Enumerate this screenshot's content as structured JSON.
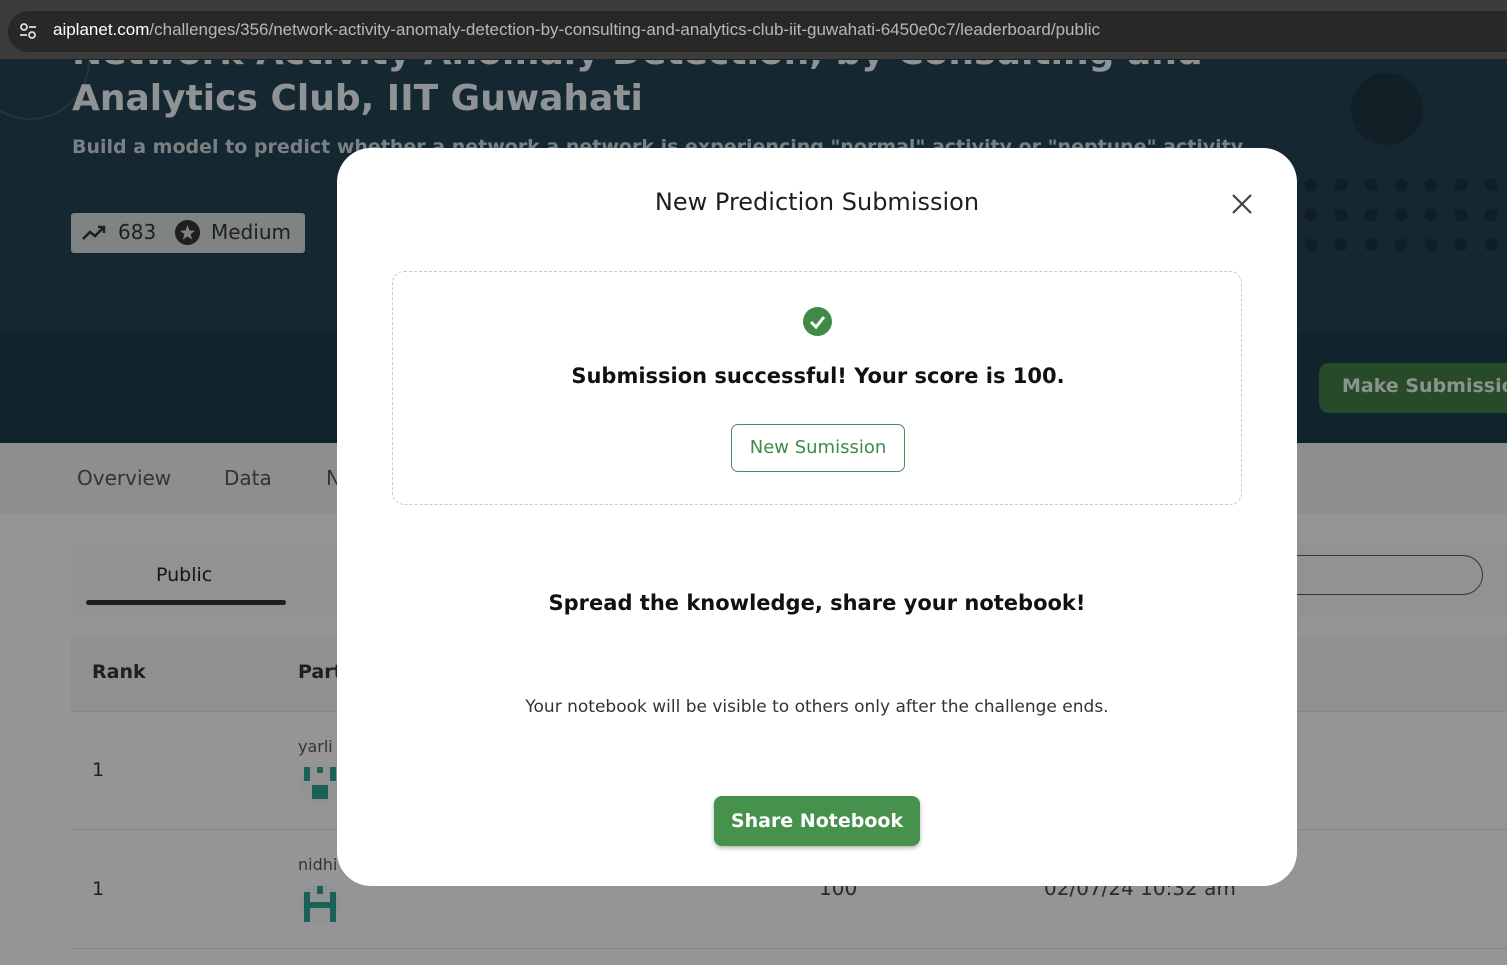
{
  "browser": {
    "url_host": "aiplanet.com",
    "url_path": "/challenges/356/network-activity-anomaly-detection-by-consulting-and-analytics-club-iit-guwahati-6450e0c7/leaderboard/public",
    "icons": {
      "site_info": "tune-icon"
    }
  },
  "hero": {
    "title": "Network Activity Anomaly Detection, by Consulting and Analytics Club, IIT Guwahati",
    "subtitle": "Build a model to predict whether a network a network is experiencing \"normal\" activity or \"neptune\" activity",
    "participants_count": "683",
    "difficulty": "Medium",
    "icons": {
      "count": "trending-up-icon",
      "difficulty": "star-badge-icon"
    }
  },
  "actions": {
    "make_submission_label": "Make Submission"
  },
  "tabs": [
    {
      "label": "Overview"
    },
    {
      "label": "Data"
    },
    {
      "label": "N"
    }
  ],
  "leaderboard": {
    "active_tab": "Public",
    "columns": {
      "rank": "Rank",
      "participant": "Part"
    },
    "rows": [
      {
        "rank": "1",
        "user": "yarli",
        "score": "",
        "date": ""
      },
      {
        "rank": "1",
        "user": "nidhi",
        "score": "100",
        "date": "02/07/24 10:32 am"
      }
    ]
  },
  "modal": {
    "title": "New Prediction Submission",
    "success_message": "Submission successful! Your score is 100.",
    "new_submission_label": "New Sumission",
    "share_heading": "Spread the knowledge, share your notebook!",
    "visibility_note": "Your notebook will be visible to others only after the challenge ends.",
    "share_button_label": "Share Notebook",
    "icons": {
      "close": "close-icon",
      "success": "check-circle-icon"
    }
  },
  "colors": {
    "accent_green": "#46914b",
    "hero_bg": "#23404e",
    "band_bg": "#1c3a4a"
  }
}
